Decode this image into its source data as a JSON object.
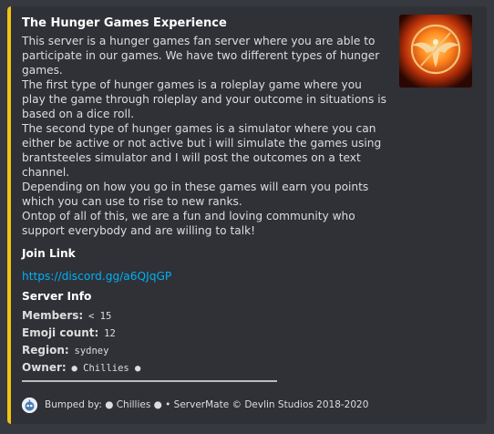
{
  "embed": {
    "accent_color": "#f1c40f",
    "title": "The Hunger Games Experience",
    "description": "This server is a hunger games fan server where you are able to participate in our games. We have two different types of hunger games.\nThe first type of hunger games is a roleplay game where you play the game through roleplay and your outcome in situations is based on a dice roll.\nThe second type of hunger games is a simulator where you can either be active or not active but i will simulate the games using brantsteeles simulator and I will post the outcomes on a text channel.\nDepending on how you go in these games will earn you points which you can use to rise to new ranks.\nOntop of all of this, we are a fun and loving community who support everybody and are willing to talk!",
    "join_link_label": "Join Link",
    "join_link_url": "https://discord.gg/a6QJqGP",
    "server_info_label": "Server Info",
    "info": {
      "members_label": "Members:",
      "members_value": "< 15",
      "emoji_label": "Emoji count:",
      "emoji_value": "12",
      "region_label": "Region:",
      "region_value": "sydney",
      "owner_label": "Owner:",
      "owner_value": "● Chillies ●"
    },
    "footer_text": "Bumped by: ● Chillies ● • ServerMate © Devlin Studios 2018-2020",
    "thumbnail_icon": "mockingjay-fire-icon",
    "footer_icon": "servermate-bot-icon"
  }
}
